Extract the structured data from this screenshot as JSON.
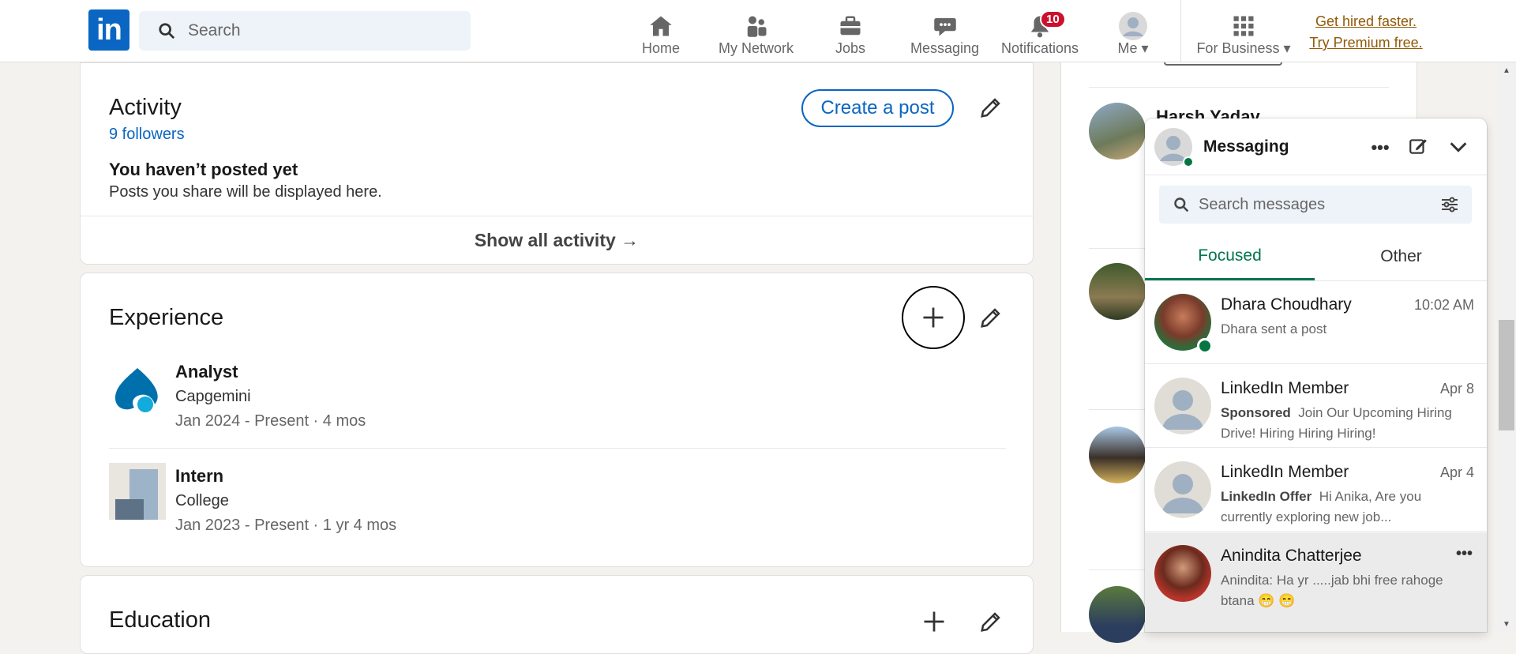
{
  "header": {
    "logo_text": "in",
    "search_placeholder": "Search",
    "nav": [
      {
        "label": "Home",
        "icon": "home-icon"
      },
      {
        "label": "My Network",
        "icon": "network-icon"
      },
      {
        "label": "Jobs",
        "icon": "briefcase-icon"
      },
      {
        "label": "Messaging",
        "icon": "chat-icon"
      },
      {
        "label": "Notifications",
        "icon": "bell-icon",
        "badge": "10"
      },
      {
        "label": "Me",
        "icon": "avatar-icon"
      },
      {
        "label": "For Business",
        "icon": "grid-icon"
      }
    ],
    "premium_line1": "Get hired faster.",
    "premium_line2": "Try Premium free."
  },
  "activity": {
    "title": "Activity",
    "followers": "9 followers",
    "create_post": "Create a post",
    "empty_title": "You haven’t posted yet",
    "empty_body": "Posts you share will be displayed here.",
    "show_all": "Show all activity →"
  },
  "experience": {
    "title": "Experience",
    "items": [
      {
        "title": "Analyst",
        "company": "Capgemini",
        "dates": "Jan 2024 - Present · 4 mos"
      },
      {
        "title": "Intern",
        "company": "College",
        "dates": "Jan 2023 - Present · 1 yr 4 mos"
      }
    ]
  },
  "education": {
    "title": "Education"
  },
  "rail": {
    "partial_name": "Harsh Yadav"
  },
  "messaging": {
    "title": "Messaging",
    "search_placeholder": "Search messages",
    "tabs": [
      "Focused",
      "Other"
    ],
    "conversations": [
      {
        "name": "Dhara Choudhary",
        "time": "10:02 AM",
        "prefix": "",
        "text": "Dhara sent a post"
      },
      {
        "name": "LinkedIn Member",
        "time": "Apr 8",
        "prefix": "Sponsored",
        "text": "Join Our Upcoming Hiring Drive! Hiring Hiring Hiring!"
      },
      {
        "name": "LinkedIn Member",
        "time": "Apr 4",
        "prefix": "LinkedIn Offer",
        "text": "Hi Anika, Are you currently exploring new job..."
      },
      {
        "name": "Anindita Chatterjee",
        "time": "",
        "prefix": "",
        "text": "Anindita: Ha yr .....jab bhi free rahoge btana 😁 😁"
      }
    ]
  },
  "colors": {
    "brand": "#0a66c2",
    "online": "#057642",
    "badge": "#cb112d"
  }
}
